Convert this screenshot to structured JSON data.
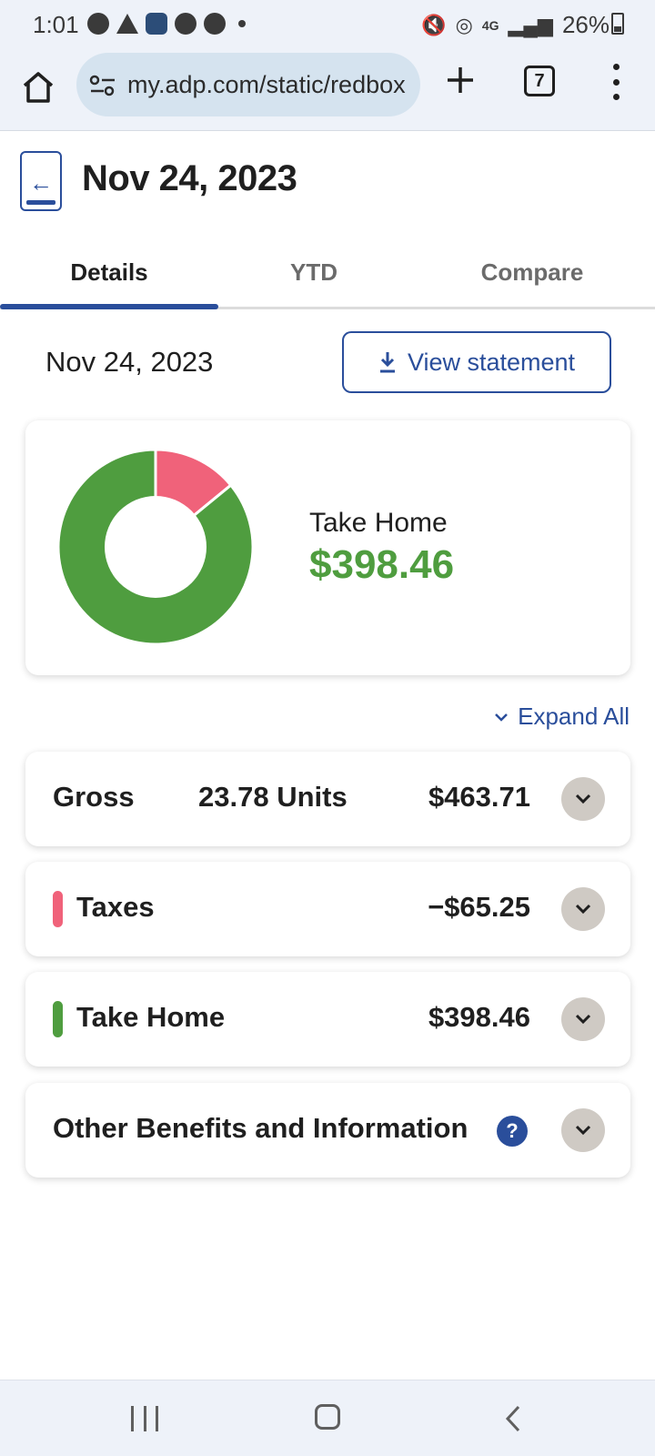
{
  "status_bar": {
    "time": "1:01",
    "network": "4G",
    "battery": "26%",
    "icons_left": [
      "message-icon",
      "warning-icon",
      "amazon-icon",
      "chrome-icon",
      "chrome-icon",
      "dot-icon"
    ],
    "icons_right": [
      "mute-icon",
      "hotspot-icon",
      "lte-icon",
      "signal-icon",
      "battery-icon"
    ]
  },
  "browser": {
    "url": "my.adp.com/static/redbox",
    "tab_count": "7"
  },
  "header": {
    "title": "Nov 24, 2023"
  },
  "tabs": [
    {
      "label": "Details",
      "active": true
    },
    {
      "label": "YTD",
      "active": false
    },
    {
      "label": "Compare",
      "active": false
    }
  ],
  "statement": {
    "date": "Nov 24, 2023",
    "view_label": "View statement"
  },
  "summary": {
    "label": "Take Home",
    "amount": "$398.46"
  },
  "chart_data": {
    "type": "pie",
    "categories": [
      "Taxes",
      "Take Home"
    ],
    "values": [
      65.25,
      398.46
    ],
    "colors": [
      "#f0627a",
      "#4f9d3f"
    ],
    "donut": true
  },
  "expand_all_label": "Expand All",
  "rows": {
    "gross": {
      "label": "Gross",
      "units": "23.78 Units",
      "amount": "$463.71"
    },
    "taxes": {
      "label": "Taxes",
      "amount": "−$65.25",
      "color": "#f0627a"
    },
    "take_home": {
      "label": "Take Home",
      "amount": "$398.46",
      "color": "#4f9d3f"
    },
    "other": {
      "label": "Other Benefits and Information",
      "help": "?"
    }
  },
  "colors": {
    "accent": "#2a4e9b",
    "take_home": "#4f9d3f",
    "taxes": "#f0627a",
    "expand_button": "#cfcac4"
  }
}
